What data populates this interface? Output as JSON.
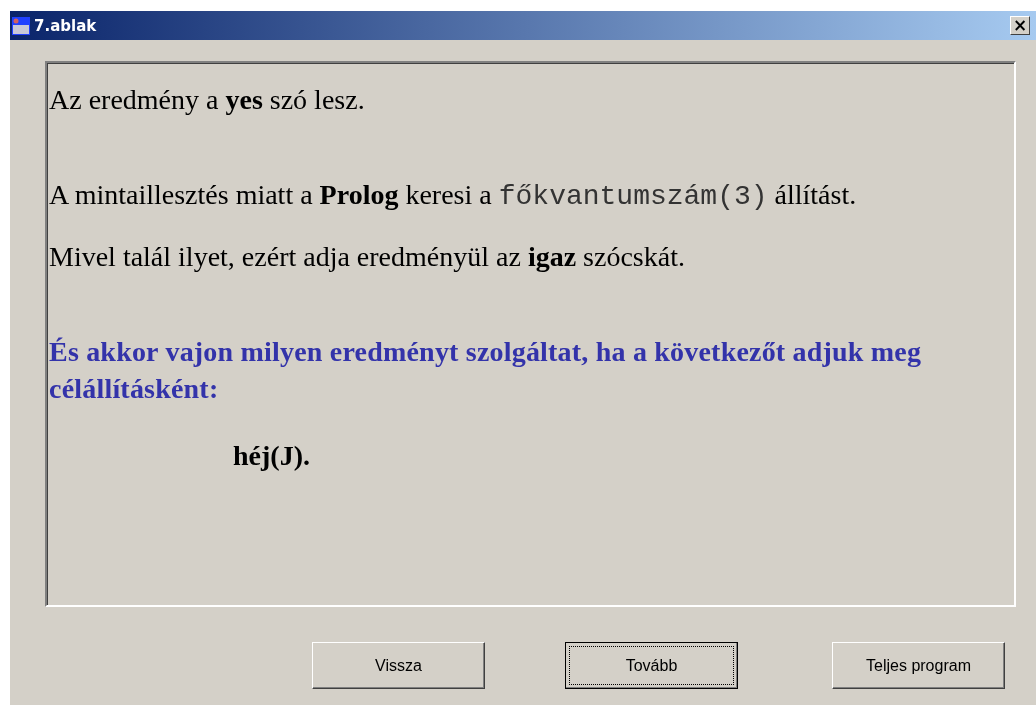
{
  "window": {
    "title": "7.ablak",
    "close": "×"
  },
  "blocks": [
    [
      {
        "kind": "text",
        "segments": [
          {
            "kind": "plain",
            "text": "Az eredmény a "
          },
          {
            "kind": "bold",
            "text": "yes"
          },
          {
            "kind": "plain",
            "text": " szó lesz."
          }
        ]
      }
    ],
    [
      {
        "kind": "text",
        "segments": [
          {
            "kind": "plain",
            "text": "A mintaillesztés miatt a "
          },
          {
            "kind": "bold",
            "text": "Prolog"
          },
          {
            "kind": "plain",
            "text": " keresi a "
          },
          {
            "kind": "mono",
            "text": "főkvantumszám(3)"
          },
          {
            "kind": "plain",
            "text": " állítást."
          }
        ]
      },
      {
        "kind": "text",
        "segments": [
          {
            "kind": "plain",
            "text": "Mivel talál ilyet, ezért adja eredményül az "
          },
          {
            "kind": "bold",
            "text": "igaz"
          },
          {
            "kind": "plain",
            "text": " szócskát."
          }
        ]
      }
    ],
    [
      {
        "kind": "question",
        "segments": [
          {
            "kind": "plain",
            "text": "És akkor vajon milyen eredményt szolgáltat, ha a következőt adjuk meg célállításként:"
          }
        ]
      },
      {
        "kind": "code",
        "segments": [
          {
            "kind": "plain",
            "text": "héj(J)."
          }
        ]
      }
    ]
  ],
  "buttons": [
    {
      "label": "Vissza",
      "focused": false
    },
    {
      "label": "Tovább",
      "focused": true
    },
    {
      "label": "Teljes program",
      "focused": false
    }
  ]
}
